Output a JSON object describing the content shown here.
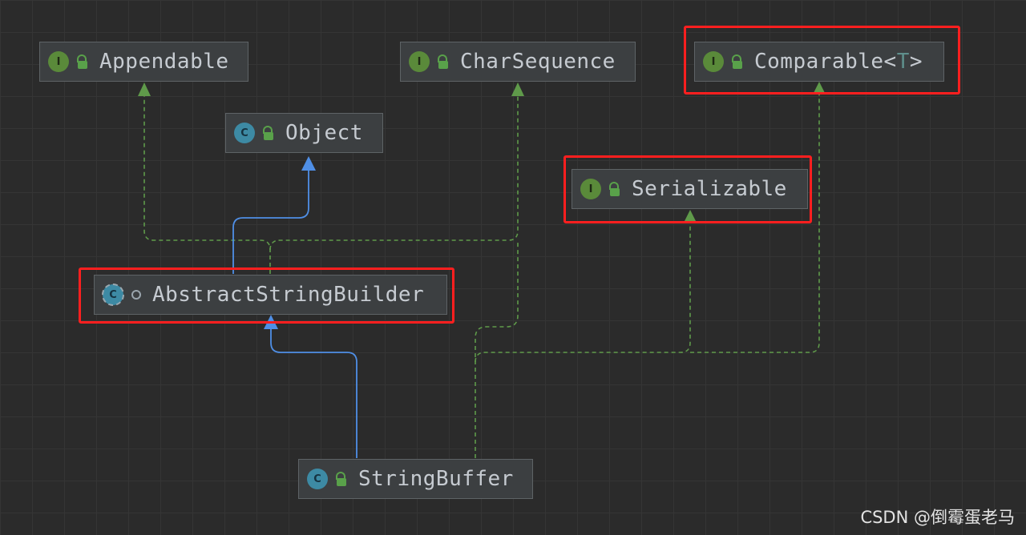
{
  "nodes": {
    "appendable": {
      "name": "Appendable",
      "kind": "interface",
      "badge": "I"
    },
    "charsequence": {
      "name": "CharSequence",
      "kind": "interface",
      "badge": "I"
    },
    "comparable": {
      "name": "Comparable",
      "type_param": "T",
      "type_open": "<",
      "type_close": ">",
      "kind": "interface",
      "badge": "I"
    },
    "object": {
      "name": "Object",
      "kind": "class",
      "badge": "C"
    },
    "serializable": {
      "name": "Serializable",
      "kind": "interface",
      "badge": "I"
    },
    "abstractstringbuilder": {
      "name": "AbstractStringBuilder",
      "kind": "abstract class",
      "badge": "C"
    },
    "stringbuffer": {
      "name": "StringBuffer",
      "kind": "final class",
      "badge": "C"
    }
  },
  "edges": [
    {
      "from": "stringbuffer",
      "to": "abstractstringbuilder",
      "relation": "extends"
    },
    {
      "from": "abstractstringbuilder",
      "to": "object",
      "relation": "extends"
    },
    {
      "from": "abstractstringbuilder",
      "to": "appendable",
      "relation": "implements"
    },
    {
      "from": "abstractstringbuilder",
      "to": "charsequence",
      "relation": "implements"
    },
    {
      "from": "stringbuffer",
      "to": "charsequence",
      "relation": "implements"
    },
    {
      "from": "stringbuffer",
      "to": "serializable",
      "relation": "implements"
    },
    {
      "from": "stringbuffer",
      "to": "comparable",
      "relation": "implements"
    }
  ],
  "highlighted": [
    "comparable",
    "serializable",
    "abstractstringbuilder"
  ],
  "colors": {
    "extends_edge": "#4f8fe6",
    "implements_edge": "#5f9a4a",
    "highlight_box": "#ff1f1f",
    "interface_badge": "#5a8a3a",
    "class_badge": "#3d8aa4"
  },
  "watermark": "CSDN @倒霉蛋老马"
}
